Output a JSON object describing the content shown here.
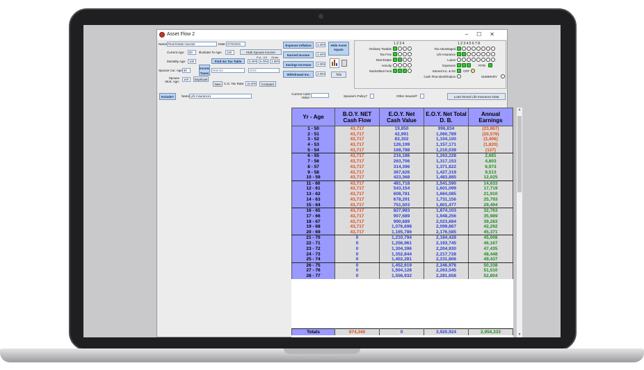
{
  "window": {
    "title": "Asset Flow 2",
    "minimize": "–",
    "maximize": "☐",
    "close": "✕"
  },
  "top": {
    "name_label": "Name:",
    "name_value": "Real Estate Investor",
    "date_label": "Date:",
    "date_value": "07/22/201",
    "current_age_label": "Current Age:",
    "current_age_value": "50",
    "illustrate_label": "Illustrate To Age:",
    "illustrate_value": "120",
    "mortality_label": "Mortality Age:",
    "mortality_value": "100",
    "spouse_age_label": "Spouse Cur. Age:",
    "spouse_age_value": "50",
    "spouse_mort_label": "Spouse Mort. Age:",
    "spouse_mort_value": "100",
    "spouse_income_btn": "Hide Spouse Income Deposits?",
    "find_tax_btn": "Find Inc Tax Table",
    "income_taxes_btn": "Income Taxes",
    "duplicate_btn": "Duplicate",
    "new_btn": "New",
    "cg_tax_label": "C.G. Tax Rate:",
    "cg_tax_value": "15.00%",
    "compare_btn": "Compare",
    "rate_headers": [
      "Est. US",
      "State",
      "NIIT"
    ],
    "rate_values": [
      "5.00%",
      "6.00%",
      "3.80%"
    ],
    "status_select": "Married",
    "year_select": "2019"
  },
  "mid": {
    "expense_inflation_btn": "Expense Inflation",
    "expense_inflation_value": "3.00%",
    "earned_income_btn": "Earned Income",
    "earned_income_value": "3.00%",
    "savings_increase_btn": "Savings Increase",
    "savings_increase_value": "3.00%",
    "withdrawal_btn": "Withdrawal Inc.",
    "withdrawal_value": "3.00%",
    "hide_inputs_btn": "Hide Asset Inputs",
    "title_btn": "Title"
  },
  "right_panel": {
    "left_numbers": "1  2  3  4",
    "right_numbers": "1  2  3  4  5  6  7  8",
    "left_rows": [
      "Ordinary Taxable",
      "Tax Free",
      "Real Estate",
      "Annuity",
      "Stocks/Mut.Fund"
    ],
    "right_rows": [
      "Tax Advantaged",
      "Life Insurance",
      "Loans",
      "Expenses",
      "Earned Inc. & SS",
      "Cash Flow Identification"
    ],
    "pitb_label": "PITB",
    "crt_label": "CRT",
    "summary_label": "SUMMARY"
  },
  "insurance_row": {
    "include_btn": "Include?",
    "name_label": "Name:",
    "name_value": "Life Insurance1",
    "current_cash_label": "Current Cash Value:",
    "spouse_policy_label": "Spouse's Policy?",
    "other_insured_label": "Other Insured?",
    "load_btn": "Load Stored Life Insurance Data"
  },
  "table": {
    "headers": [
      "Yr - Age",
      "B.O.Y. NET Cash Flow",
      "E.O.Y. Net Cash Value",
      "E.O.Y. Net Total D. B.",
      "Annual Earnings"
    ],
    "rows": [
      [
        "1 - 50",
        "43,717",
        "19,850",
        "996,834",
        "(23,867)"
      ],
      [
        "2 - 51",
        "43,717",
        "42,991",
        "1,060,789",
        "(20,576)"
      ],
      [
        "3 - 52",
        "43,717",
        "83,302",
        "1,104,100",
        "(3,406)"
      ],
      [
        "4 - 53",
        "43,717",
        "126,199",
        "1,157,171",
        "(1,820)"
      ],
      [
        "5 - 54",
        "43,717",
        "168,788",
        "1,210,039",
        "(127)"
      ],
      [
        "6 - 55",
        "43,717",
        "216,186",
        "1,263,228",
        "2,681"
      ],
      [
        "7 - 56",
        "43,717",
        "263,706",
        "1,317,153",
        "4,803"
      ],
      [
        "8 - 57",
        "43,717",
        "314,396",
        "1,371,822",
        "6,973"
      ],
      [
        "9 - 58",
        "43,717",
        "367,626",
        "1,427,319",
        "9,513"
      ],
      [
        "10 - 59",
        "43,717",
        "423,368",
        "1,483,885",
        "12,025"
      ],
      [
        "11 - 60",
        "43,717",
        "481,718",
        "1,541,590",
        "14,633"
      ],
      [
        "12 - 61",
        "43,717",
        "543,154",
        "1,601,099",
        "17,719"
      ],
      [
        "13 - 62",
        "43,717",
        "608,781",
        "1,664,085",
        "21,910"
      ],
      [
        "14 - 63",
        "43,717",
        "678,291",
        "1,731,156",
        "25,793"
      ],
      [
        "15 - 64",
        "43,717",
        "751,503",
        "1,801,477",
        "29,494"
      ],
      [
        "16 - 65",
        "43,717",
        "827,983",
        "1,874,103",
        "32,763"
      ],
      [
        "17 - 66",
        "43,717",
        "907,689",
        "1,948,256",
        "35,989"
      ],
      [
        "18 - 67",
        "43,717",
        "990,689",
        "2,023,684",
        "39,283"
      ],
      [
        "19 - 68",
        "43,717",
        "1,076,698",
        "2,099,867",
        "42,292"
      ],
      [
        "20 - 69",
        "43,717",
        "1,165,786",
        "2,176,585",
        "45,371"
      ],
      [
        "21 - 70",
        "0",
        "1,210,794",
        "2,184,428",
        "45,008"
      ],
      [
        "22 - 71",
        "0",
        "1,256,961",
        "2,193,745",
        "46,167"
      ],
      [
        "23 - 72",
        "0",
        "1,304,396",
        "2,204,930",
        "47,435"
      ],
      [
        "24 - 73",
        "0",
        "1,352,844",
        "2,217,728",
        "48,448"
      ],
      [
        "25 - 74",
        "0",
        "1,402,281",
        "2,231,806",
        "49,437"
      ],
      [
        "26 - 75",
        "0",
        "1,452,619",
        "2,246,976",
        "50,338"
      ],
      [
        "27 - 76",
        "0",
        "1,504,128",
        "2,263,545",
        "51,510"
      ],
      [
        "28 - 77",
        "0",
        "1,556,932",
        "2,281,658",
        "52,804"
      ]
    ],
    "totals": [
      "Totals",
      "874,340",
      "0",
      "3,920,924",
      "2,954,333"
    ]
  }
}
